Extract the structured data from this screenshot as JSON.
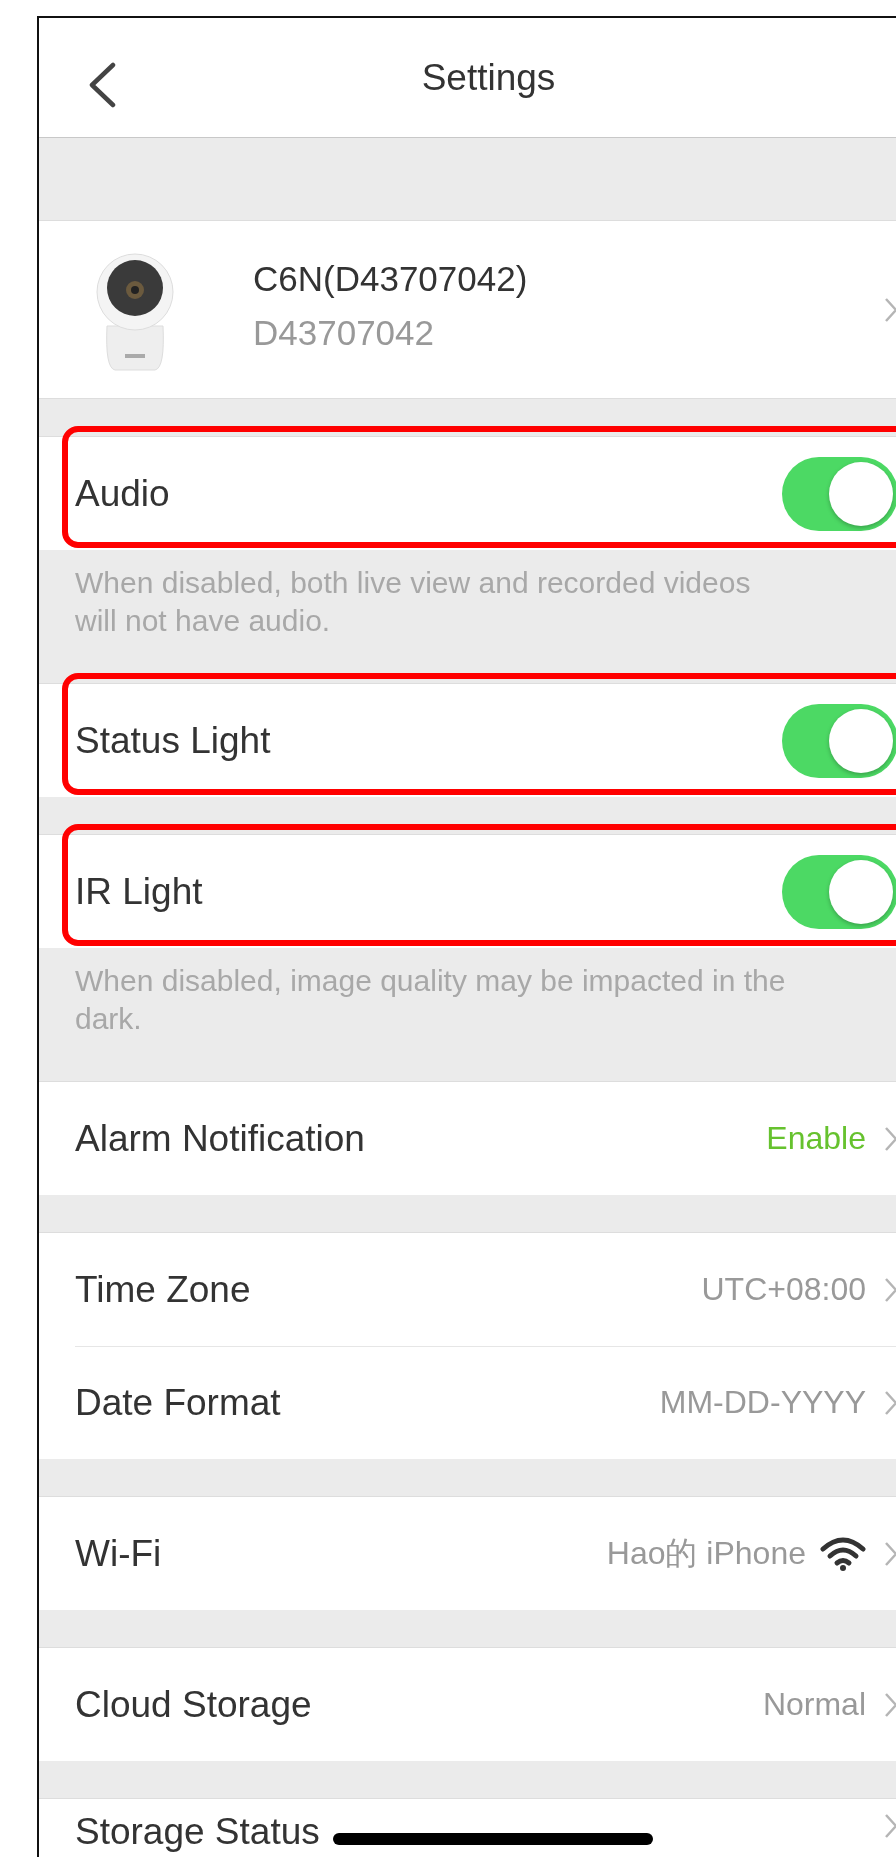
{
  "header": {
    "title": "Settings"
  },
  "device": {
    "name": "C6N(D43707042)",
    "serial": "D43707042"
  },
  "groups": [
    {
      "rows": [
        {
          "kind": "toggle",
          "label": "Audio",
          "on": true,
          "highlighted": true
        }
      ],
      "note": "When disabled, both live view and recorded videos will not have audio."
    },
    {
      "rows": [
        {
          "kind": "toggle",
          "label": "Status Light",
          "on": true,
          "highlighted": true
        }
      ]
    },
    {
      "rows": [
        {
          "kind": "toggle",
          "label": "IR Light",
          "on": true,
          "highlighted": true
        }
      ],
      "note": "When disabled, image quality may be impacted in the dark."
    },
    {
      "rows": [
        {
          "kind": "link",
          "label": "Alarm Notification",
          "value": "Enable",
          "color": "#66c22e"
        }
      ]
    },
    {
      "rows": [
        {
          "kind": "link",
          "label": "Time Zone",
          "value": "UTC+08:00"
        },
        {
          "kind": "link",
          "label": "Date Format",
          "value": "MM-DD-YYYY"
        }
      ]
    },
    {
      "rows": [
        {
          "kind": "wifi",
          "label": "Wi-Fi",
          "value": "Hao的 iPhone"
        }
      ]
    },
    {
      "rows": [
        {
          "kind": "link",
          "label": "Cloud Storage",
          "value": "Normal"
        }
      ]
    },
    {
      "rows": [
        {
          "kind": "link",
          "label": "Storage Status"
        }
      ]
    }
  ]
}
